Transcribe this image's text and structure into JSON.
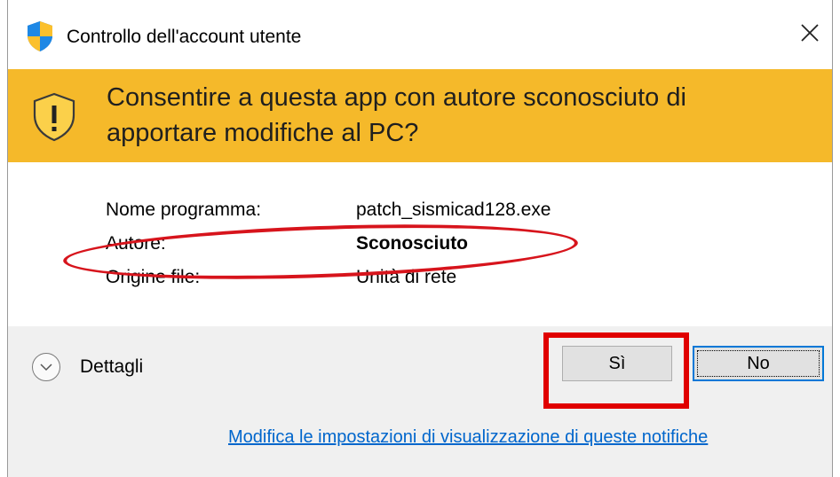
{
  "window": {
    "title": "Controllo dell'account utente",
    "title_icon": "uac-shield-icon",
    "close_icon": "close-icon"
  },
  "banner": {
    "question": "Consentire a questa app con autore sconosciuto di apportare modifiche al PC?",
    "icon": "warning-shield-icon",
    "color": "#f5b92a"
  },
  "info": {
    "rows": [
      {
        "label": "Nome programma:",
        "value": "patch_sismicad128.exe"
      },
      {
        "label": "Autore:",
        "value": "Sconosciuto"
      },
      {
        "label": "Origine file:",
        "value": "Unità di rete"
      }
    ]
  },
  "footer": {
    "details_label": "Dettagli",
    "yes_label": "Sì",
    "no_label": "No",
    "settings_link": "Modifica le impostazioni di visualizzazione di queste notifiche"
  },
  "annotations": {
    "color": "#e00000"
  }
}
